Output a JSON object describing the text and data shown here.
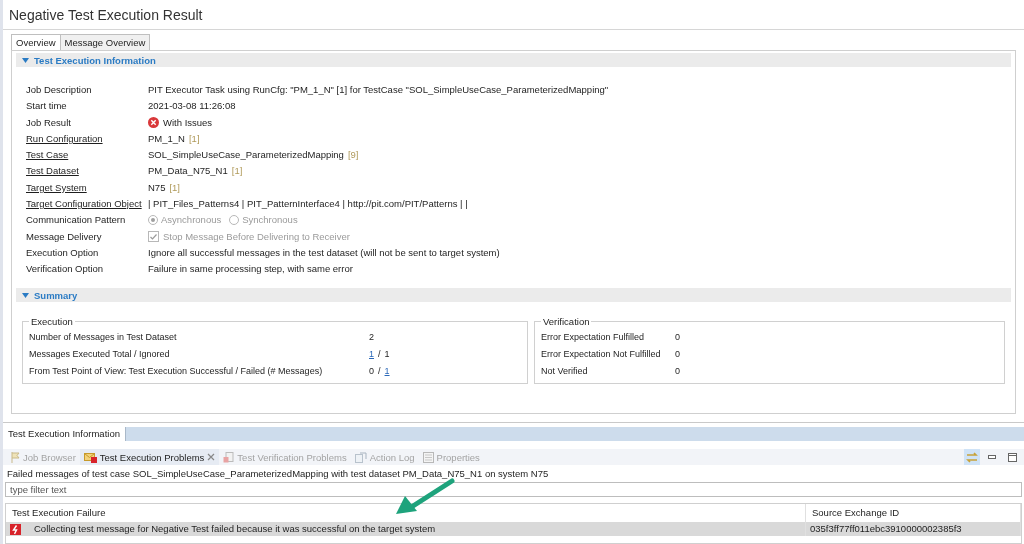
{
  "editor": {
    "title": "Negative Test Execution Result",
    "tabs": [
      {
        "label": "Overview",
        "selected": true
      },
      {
        "label": "Message Overview",
        "selected": false
      }
    ],
    "info_section": {
      "title": "Test Execution Information",
      "expanded": true,
      "fields": [
        {
          "kind": "text",
          "label": "Job Description",
          "link": false,
          "value": "PIT Executor Task using RunCfg: \"PM_1_N\" [1] for TestCase \"SOL_SimpleUseCase_ParameterizedMapping\""
        },
        {
          "kind": "text",
          "label": "Start time",
          "link": false,
          "value": "2021-03-08 11:26:08"
        },
        {
          "kind": "status",
          "label": "Job Result",
          "link": false,
          "value": "With Issues"
        },
        {
          "kind": "ref",
          "label": "Run Configuration",
          "link": true,
          "value": "PM_1_N",
          "count": "[1]"
        },
        {
          "kind": "ref",
          "label": "Test Case",
          "link": true,
          "value": "SOL_SimpleUseCase_ParameterizedMapping",
          "count": "[9]"
        },
        {
          "kind": "ref",
          "label": "Test Dataset",
          "link": true,
          "value": "PM_Data_N75_N1",
          "count": "[1]"
        },
        {
          "kind": "ref",
          "label": "Target System",
          "link": true,
          "value": "N75",
          "count": "[1]"
        },
        {
          "kind": "text",
          "label": "Target Configuration Object",
          "link": true,
          "value": "| PIT_Files_Patterns4 | PIT_PatternInterface4 | http://pit.com/PIT/Patterns |  |"
        },
        {
          "kind": "radio",
          "label": "Communication Pattern",
          "link": false,
          "disabled": true,
          "options": [
            {
              "label": "Asynchronous",
              "selected": true
            },
            {
              "label": "Synchronous",
              "selected": false
            }
          ]
        },
        {
          "kind": "checkbox",
          "label": "Message Delivery",
          "link": false,
          "disabled": true,
          "value": "Stop Message Before Delivering to Receiver",
          "checked": true
        },
        {
          "kind": "text",
          "label": "Execution Option",
          "link": false,
          "value": "Ignore all successful messages in the test dataset (will not be sent to target system)"
        },
        {
          "kind": "text",
          "label": "Verification Option",
          "link": false,
          "value": "Failure in same processing step, with same error"
        }
      ]
    },
    "summary_section": {
      "title": "Summary",
      "expanded": true,
      "groups": [
        {
          "title": "Execution",
          "rows": [
            {
              "label": "Number of Messages in Test Dataset",
              "values": [
                {
                  "text": "2",
                  "link": false
                }
              ]
            },
            {
              "label": "Messages Executed Total / Ignored",
              "values": [
                {
                  "text": "1",
                  "link": true
                },
                {
                  "text": "1",
                  "link": false
                }
              ],
              "separator": "/"
            },
            {
              "label": "From Test Point of View: Test Execution Successful / Failed (# Messages)",
              "values": [
                {
                  "text": "0",
                  "link": false
                },
                {
                  "text": "1",
                  "link": true
                }
              ],
              "separator": "/"
            }
          ]
        },
        {
          "title": "Verification",
          "rows": [
            {
              "label": "Error Expectation Fulfilled",
              "values": [
                {
                  "text": "0",
                  "link": false
                }
              ]
            },
            {
              "label": "Error Expectation Not Fulfilled",
              "values": [
                {
                  "text": "0",
                  "link": false
                }
              ]
            },
            {
              "label": "Not Verified",
              "values": [
                {
                  "text": "0",
                  "link": false
                }
              ]
            }
          ]
        }
      ]
    }
  },
  "bottom_tabs": [
    {
      "label": "Test Execution Information",
      "selected": true
    }
  ],
  "views": {
    "tabs": [
      {
        "kind": "flag",
        "label": "Job Browser",
        "selected": false
      },
      {
        "kind": "problems",
        "label": "Test Execution Problems",
        "selected": true
      },
      {
        "kind": "verification",
        "label": "Test Verification Problems",
        "selected": false
      },
      {
        "kind": "log",
        "label": "Action Log",
        "selected": false
      },
      {
        "kind": "properties",
        "label": "Properties",
        "selected": false
      }
    ],
    "description": "Failed messages of test case SOL_SimpleUseCase_ParameterizedMapping with test dataset PM_Data_N75_N1 on system N75",
    "filter": {
      "placeholder": "type filter text"
    },
    "table": {
      "columns": [
        "Test Execution Failure",
        "Source Exchange ID"
      ],
      "rows": [
        {
          "cells": [
            "Collecting test message for Negative Test failed because it was successful on the target system",
            "035f3ff77ff011ebc3910000002385f3"
          ],
          "selected": true
        }
      ]
    }
  }
}
